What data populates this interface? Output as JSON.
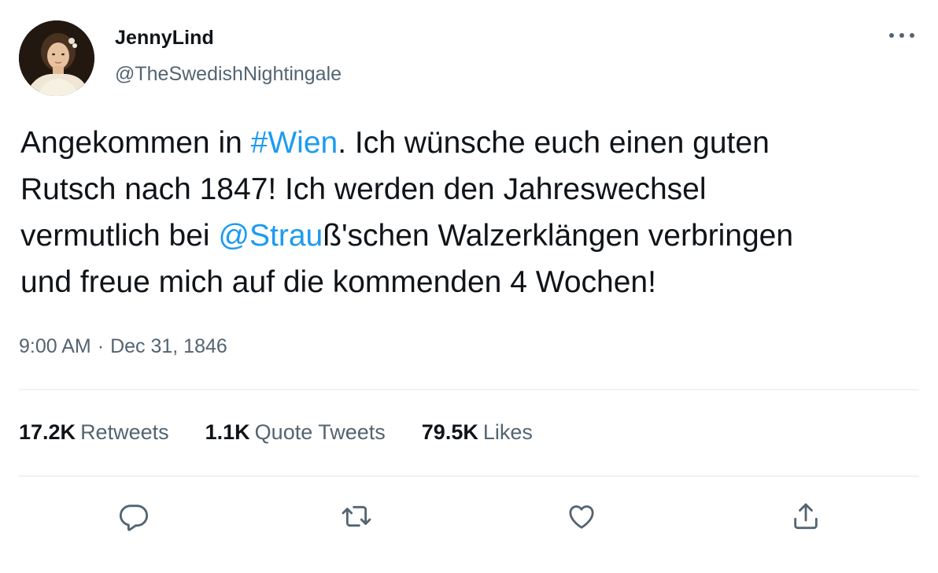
{
  "author": {
    "display_name": "JennyLind",
    "handle": "@TheSwedishNightingale",
    "avatar_icon": "portrait-avatar"
  },
  "tweet": {
    "text_parts": {
      "p1": "Angekommen in ",
      "hashtag": "#Wien",
      "p2": ". Ich wünsche euch einen guten",
      "line2": "Rutsch nach 1847! Ich werden den Jahreswechsel",
      "p3": "vermutlich bei ",
      "mention": "@Strau",
      "p4": "ß'schen Walzerklängen verbringen",
      "line4": "und freue mich auf die kommenden 4 Wochen!"
    },
    "time": "9:00 AM",
    "separator": "·",
    "date": "Dec 31, 1846"
  },
  "stats": {
    "retweets_count": "17.2K",
    "retweets_label": "Retweets",
    "quotes_count": "1.1K",
    "quotes_label": "Quote Tweets",
    "likes_count": "79.5K",
    "likes_label": "Likes"
  },
  "colors": {
    "link": "#1d9bf0",
    "secondary_text": "#536471",
    "primary_text": "#0f1419",
    "divider": "#eff3f4"
  },
  "icons": {
    "more": "more-horizontal-icon",
    "reply": "reply-icon",
    "retweet": "retweet-icon",
    "like": "heart-icon",
    "share": "share-icon"
  }
}
